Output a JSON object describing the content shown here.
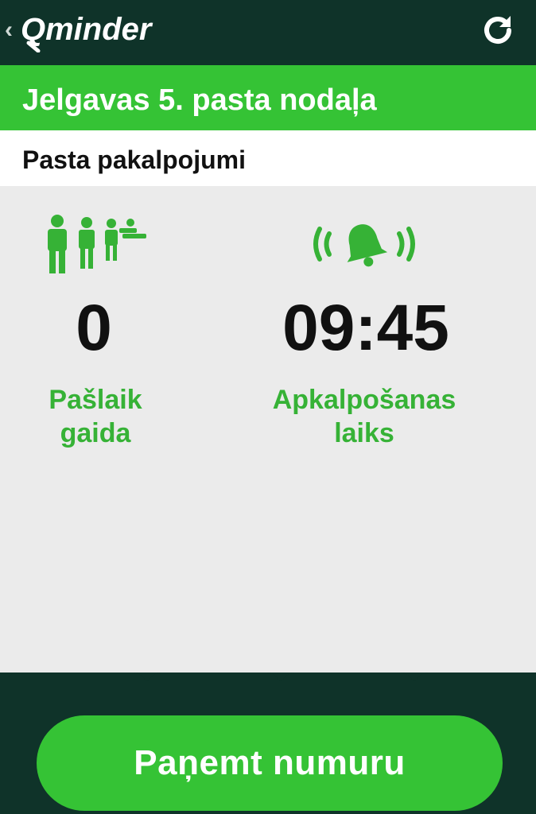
{
  "header": {
    "back_symbol": "‹",
    "logo_text": "Qminder",
    "refresh_icon": "refresh-icon"
  },
  "branch": {
    "title": "Jelgavas 5. pasta nodaļa"
  },
  "service": {
    "name": "Pasta pakalpojumi"
  },
  "stats": {
    "waiting": {
      "icon": "queue-people-icon",
      "value": "0",
      "label_line1": "Pašlaik",
      "label_line2": "gaida"
    },
    "service_time": {
      "icon": "ringing-bell-icon",
      "value": "09:45",
      "label_line1": "Apkalpošanas",
      "label_line2": "laiks"
    }
  },
  "action": {
    "take_number_label": "Paņemt numuru"
  },
  "colors": {
    "dark_green": "#0f3329",
    "accent_green": "#35c335",
    "label_green": "#36b236",
    "background": "#ebebeb"
  }
}
